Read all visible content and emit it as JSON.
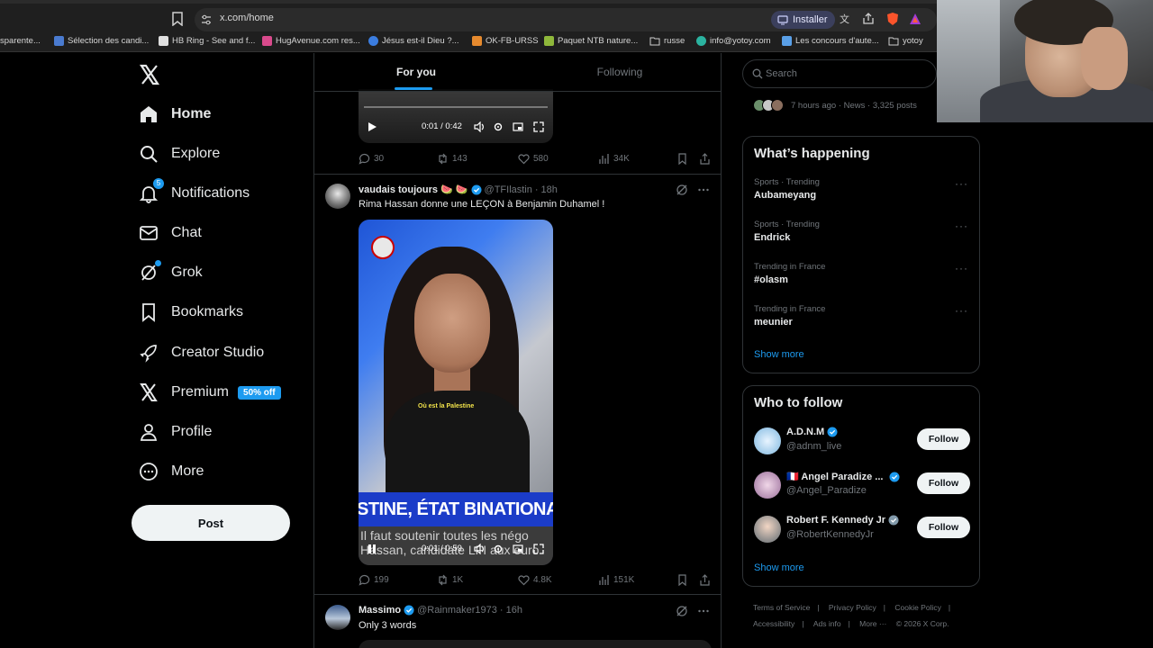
{
  "browser": {
    "url": "x.com/home",
    "install_label": "Installer",
    "bookmarks": [
      {
        "label": "sparente...",
        "color": "#5b5b5b"
      },
      {
        "label": "Sélection des candi...",
        "color": "#4a7bd0"
      },
      {
        "label": "HB Ring - See and f...",
        "color": "#e0e0e0"
      },
      {
        "label": "HugAvenue.com res...",
        "color": "#d94a8c"
      },
      {
        "label": "Jésus est-il Dieu ?...",
        "color": "#3b7de0"
      },
      {
        "label": "OK-FB-URSS",
        "color": "#e68a2e"
      },
      {
        "label": "Paquet NTB nature...",
        "color": "#8fb83b"
      },
      {
        "label": "russe",
        "color": "#c8c8c8"
      },
      {
        "label": "info@yotoy.com",
        "color": "#2bb3a0"
      },
      {
        "label": "Les concours d'aute...",
        "color": "#5aa0e8"
      },
      {
        "label": "yotoy",
        "color": "#c8c8c8"
      }
    ]
  },
  "nav": {
    "items": [
      {
        "label": "Home",
        "icon": "home-icon"
      },
      {
        "label": "Explore",
        "icon": "search-icon"
      },
      {
        "label": "Notifications",
        "icon": "bell-icon",
        "badge": "5"
      },
      {
        "label": "Chat",
        "icon": "mail-icon"
      },
      {
        "label": "Grok",
        "icon": "grok-icon"
      },
      {
        "label": "Bookmarks",
        "icon": "bookmark-icon"
      },
      {
        "label": "Creator Studio",
        "icon": "rocket-icon"
      },
      {
        "label": "Premium",
        "icon": "x-icon",
        "badge": "50% off"
      },
      {
        "label": "Profile",
        "icon": "person-icon"
      },
      {
        "label": "More",
        "icon": "more-circle-icon"
      }
    ],
    "post_label": "Post"
  },
  "feed": {
    "tabs": [
      "For you",
      "Following"
    ],
    "tweet1": {
      "video_time": "0:01 / 0:42",
      "replies": "30",
      "reposts": "143",
      "likes": "580",
      "views": "34K"
    },
    "tweet2": {
      "name": "vaudais toujours 🍉 🍉",
      "handle": "@TFIlastin",
      "time": "18h",
      "text": "Rima Hassan donne une LEÇON à Benjamin Duhamel !",
      "video_caption": "Où est la Palestine",
      "video_banner": "STINE, ÉTAT BINATIONAL",
      "video_subtitle_1": "Il faut soutenir toutes les négo",
      "video_subtitle_2": "Hassan, candidate LFI aux euro",
      "video_time": "0:01 / 0:59",
      "replies": "199",
      "reposts": "1K",
      "likes": "4.8K",
      "views": "151K"
    },
    "tweet3": {
      "name": "Massimo",
      "handle": "@Rainmaker1973",
      "time": "16h",
      "text": "Only 3 words"
    }
  },
  "sidebar": {
    "search_placeholder": "Search",
    "news_meta": "7 hours ago · News · 3,325 posts",
    "happening_title": "What’s happening",
    "trends": [
      {
        "category": "Sports · Trending",
        "name": "Aubameyang"
      },
      {
        "category": "Sports · Trending",
        "name": "Endrick"
      },
      {
        "category": "Trending in France",
        "name": "#olasm"
      },
      {
        "category": "Trending in France",
        "name": "meunier"
      }
    ],
    "show_more": "Show more",
    "follow_title": "Who to follow",
    "follow": [
      {
        "name": "A.D.N.M",
        "handle": "@adnm_live",
        "verified": "blue"
      },
      {
        "name": "🇫🇷 Angel Paradize ...",
        "handle": "@Angel_Paradize",
        "verified": "blue"
      },
      {
        "name": "Robert F. Kennedy Jr",
        "handle": "@RobertKennedyJr",
        "verified": "gray"
      }
    ],
    "follow_label": "Follow",
    "footer": [
      "Terms of Service",
      "Privacy Policy",
      "Cookie Policy",
      "Accessibility",
      "Ads info",
      "More ···",
      "© 2026 X Corp."
    ]
  },
  "colors": {
    "accent": "#1d9bf0",
    "background": "#000000",
    "border": "#2f3336",
    "muted": "#71767b"
  }
}
